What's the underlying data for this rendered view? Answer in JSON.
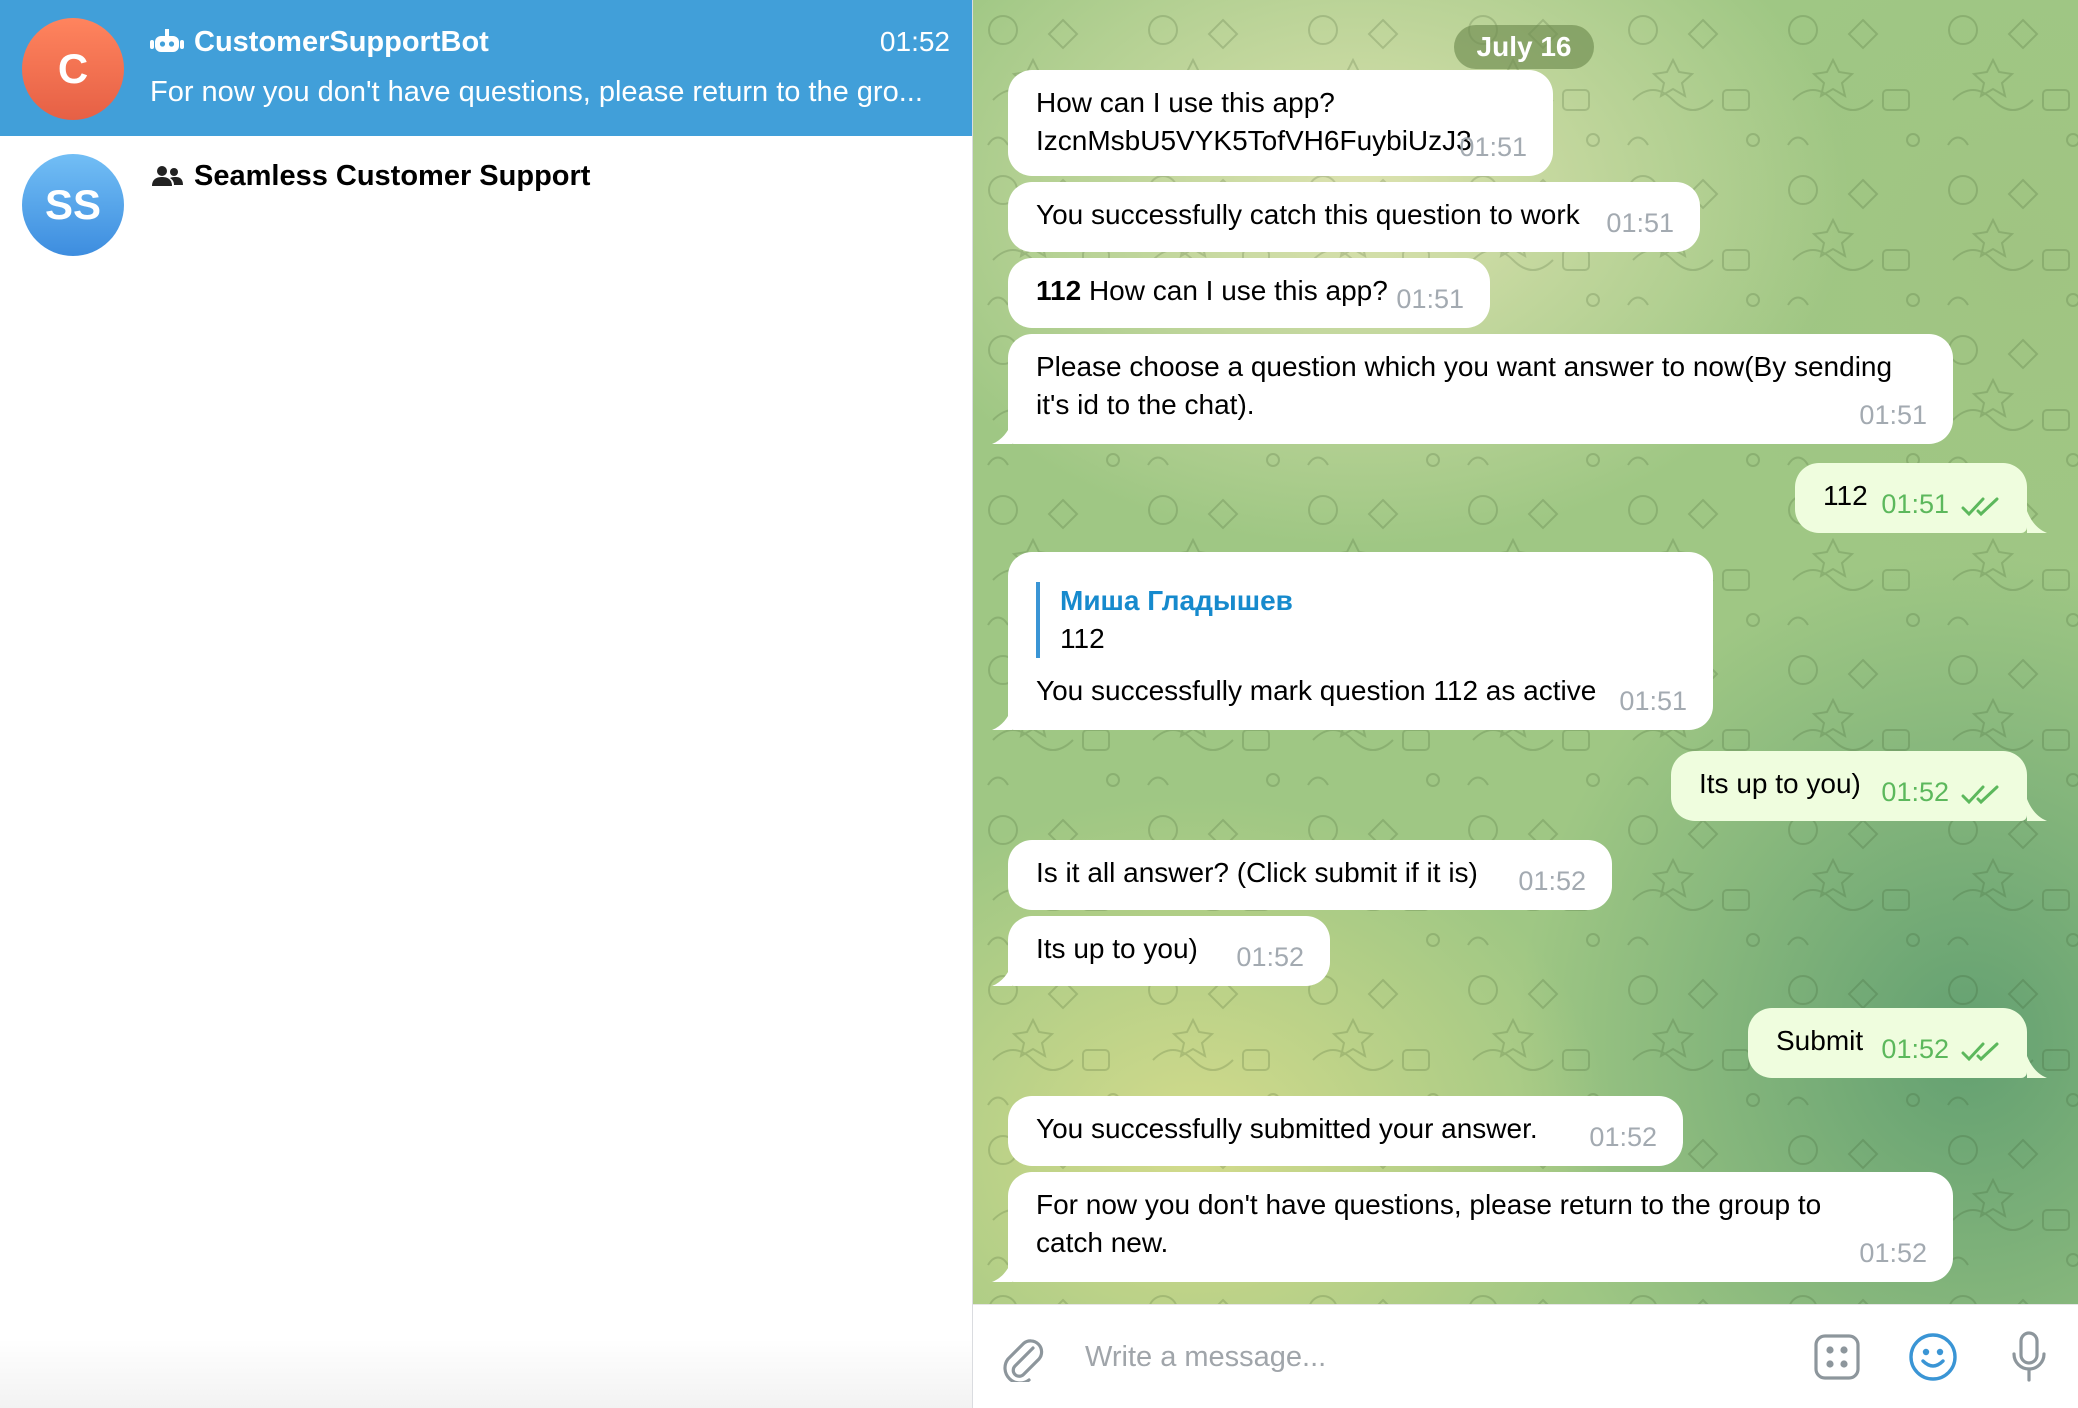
{
  "sidebar": {
    "chats": [
      {
        "avatar_initials": "C",
        "avatar_color": "#e96e4f",
        "icon": "bot-icon",
        "title": "CustomerSupportBot",
        "time": "01:52",
        "preview": "For now you don't have questions, please return to the gro...",
        "active": true
      },
      {
        "avatar_initials": "SS",
        "avatar_color": "#4a9ae6",
        "icon": "group-icon",
        "title": "Seamless Customer Support",
        "time": "",
        "preview": "",
        "active": false
      }
    ]
  },
  "chat": {
    "date_label": "July 16",
    "messages": [
      {
        "direction": "in",
        "lines": [
          "How can I use this app?",
          "IzcnMsbU5VYK5TofVH6FuybiUzJ3"
        ],
        "time": "01:51"
      },
      {
        "direction": "in",
        "text": "You successfully catch this question to work",
        "time": "01:51"
      },
      {
        "direction": "in",
        "bold_prefix": "112",
        "text": " How can I use this app?",
        "time": "01:51"
      },
      {
        "direction": "in",
        "lines": [
          "Please choose a question which you want answer to now(By sending",
          "it's id to the chat)."
        ],
        "time": "01:51"
      },
      {
        "direction": "out",
        "text": "112",
        "time": "01:51",
        "read": true
      },
      {
        "direction": "in",
        "reply_author": "Миша Гладышев",
        "reply_text": "112",
        "text": "You successfully mark question 112 as active",
        "time": "01:51"
      },
      {
        "direction": "out",
        "text": "Its up to you)",
        "time": "01:52",
        "read": true
      },
      {
        "direction": "in",
        "text": "Is it all answer? (Click submit if it is)",
        "time": "01:52"
      },
      {
        "direction": "in",
        "text": "Its up to you)",
        "time": "01:52"
      },
      {
        "direction": "out",
        "text": "Submit",
        "time": "01:52",
        "read": true
      },
      {
        "direction": "in",
        "text": "You successfully submitted your answer.",
        "time": "01:52"
      },
      {
        "direction": "in",
        "lines": [
          "For now you don't have questions, please return to the group to",
          "catch new."
        ],
        "time": "01:52"
      }
    ]
  },
  "composer": {
    "placeholder": "Write a message...",
    "icons": [
      "paperclip-icon",
      "bot-commands-icon",
      "emoji-icon",
      "microphone-icon"
    ]
  },
  "colors": {
    "active_chat": "#419fd9",
    "incoming_bubble": "#ffffff",
    "outgoing_bubble": "#effdde",
    "outgoing_time": "#5cb85c",
    "link_blue": "#168acd"
  }
}
